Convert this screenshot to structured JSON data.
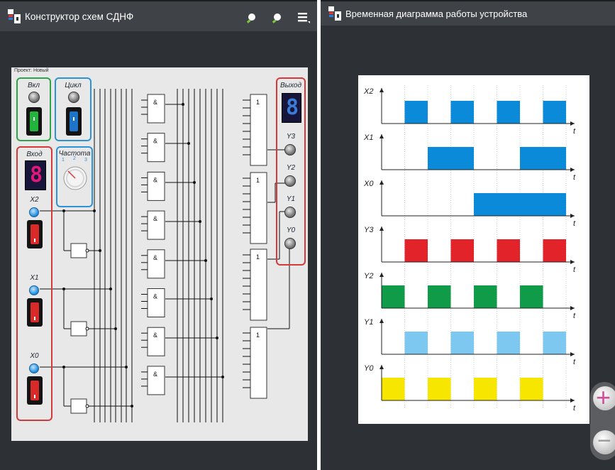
{
  "left_window": {
    "title": "Конструктор схем СДНФ",
    "toolbar_icons": [
      "magnifier-icon",
      "magnifier-icon",
      "menu-icon"
    ],
    "project_label": "Проект: Новый",
    "panel_power": {
      "label": "Вкл",
      "switch_color": "#22b43c"
    },
    "panel_cycle": {
      "label": "Цикл",
      "switch_color": "#1e74c8"
    },
    "panel_input": {
      "label": "Вход",
      "display_digit": "8",
      "display_color": "#e0187a"
    },
    "panel_freq": {
      "label": "Частота",
      "scale": [
        "1",
        "2",
        "3"
      ]
    },
    "panel_output": {
      "label": "Выход",
      "display_digit": "8",
      "display_color": "#3a7cd8"
    },
    "inputs": [
      "X2",
      "X1",
      "X0"
    ],
    "outputs": [
      "Y3",
      "Y2",
      "Y1",
      "Y0"
    ],
    "and_gate_symbol": "&",
    "or_gate_symbol": "1",
    "and_gate_count": 8,
    "or_gate_count": 4
  },
  "right_window": {
    "title": "Временная диаграмма работы устройства"
  },
  "chart_data": {
    "type": "timing",
    "time_label": "t",
    "time_slots": 8,
    "signals": [
      {
        "name": "X2",
        "color": "#0a8ad8",
        "levels": [
          0,
          1,
          0,
          1,
          0,
          1,
          0,
          1
        ]
      },
      {
        "name": "X1",
        "color": "#0a8ad8",
        "levels": [
          0,
          0,
          1,
          1,
          0,
          0,
          1,
          1
        ]
      },
      {
        "name": "X0",
        "color": "#0a8ad8",
        "levels": [
          0,
          0,
          0,
          0,
          1,
          1,
          1,
          1
        ]
      },
      {
        "name": "Y3",
        "color": "#e3232a",
        "levels": [
          0,
          1,
          0,
          1,
          0,
          1,
          0,
          1
        ]
      },
      {
        "name": "Y2",
        "color": "#0f9b48",
        "levels": [
          1,
          0,
          1,
          0,
          1,
          0,
          1,
          0
        ]
      },
      {
        "name": "Y1",
        "color": "#7cc8f0",
        "levels": [
          0,
          1,
          0,
          1,
          0,
          1,
          0,
          1
        ]
      },
      {
        "name": "Y0",
        "color": "#f6e600",
        "levels": [
          1,
          0,
          1,
          0,
          1,
          0,
          1,
          0
        ]
      }
    ]
  },
  "zoom_controls": {
    "zoom_in_symbol": "+",
    "zoom_out_symbol": "−",
    "zoom_in_color": "#d14d9a"
  }
}
